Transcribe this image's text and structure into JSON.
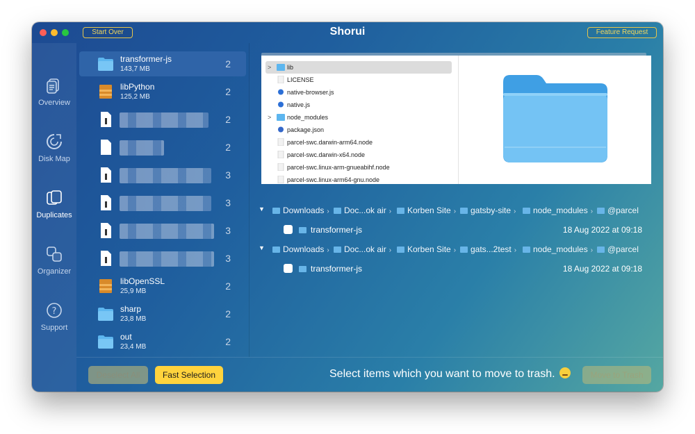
{
  "app": {
    "title": "Shorui",
    "start_over_label": "Start Over",
    "feature_request_label": "Feature Request"
  },
  "sidebar": {
    "items": [
      {
        "label": "Overview",
        "icon": "overview-icon"
      },
      {
        "label": "Disk Map",
        "icon": "disk-map-icon"
      },
      {
        "label": "Duplicates",
        "icon": "duplicates-icon",
        "active": true
      },
      {
        "label": "Organizer",
        "icon": "organizer-icon"
      },
      {
        "label": "Support",
        "icon": "support-icon"
      }
    ]
  },
  "files": [
    {
      "name": "transformer-js",
      "size": "143,7 MB",
      "count": "2",
      "icon": "folder-icon",
      "selected": true
    },
    {
      "name": "libPython",
      "size": "125,2 MB",
      "count": "2",
      "icon": "archive-icon"
    },
    {
      "name": "",
      "size": "",
      "count": "2",
      "icon": "document-icon",
      "blurred": true
    },
    {
      "name": "",
      "size": "",
      "count": "2",
      "icon": "document-icon",
      "blurred": true
    },
    {
      "name": "",
      "size": "",
      "count": "3",
      "icon": "document-icon",
      "blurred": true
    },
    {
      "name": "",
      "size": "",
      "count": "3",
      "icon": "document-icon",
      "blurred": true
    },
    {
      "name": "",
      "size": "",
      "count": "3",
      "icon": "document-icon",
      "blurred": true
    },
    {
      "name": "",
      "size": "",
      "count": "3",
      "icon": "document-icon",
      "blurred": true
    },
    {
      "name": "libOpenSSL",
      "size": "25,9 MB",
      "count": "2",
      "icon": "archive-icon"
    },
    {
      "name": "sharp",
      "size": "23,8 MB",
      "count": "2",
      "icon": "folder-icon"
    },
    {
      "name": "out",
      "size": "23,4 MB",
      "count": "2",
      "icon": "folder-icon"
    }
  ],
  "preview": {
    "tree": [
      {
        "label": "lib",
        "type": "folder",
        "expandable": true,
        "selected": true
      },
      {
        "label": "LICENSE",
        "type": "file"
      },
      {
        "label": "native-browser.js",
        "type": "js"
      },
      {
        "label": "native.js",
        "type": "js"
      },
      {
        "label": "node_modules",
        "type": "folder",
        "expandable": true
      },
      {
        "label": "package.json",
        "type": "json"
      },
      {
        "label": "parcel-swc.darwin-arm64.node",
        "type": "file"
      },
      {
        "label": "parcel-swc.darwin-x64.node",
        "type": "file"
      },
      {
        "label": "parcel-swc.linux-arm-gnueabihf.node",
        "type": "file"
      },
      {
        "label": "parcel-swc.linux-arm64-gnu.node",
        "type": "file"
      }
    ]
  },
  "groups": [
    {
      "path": [
        "Downloads",
        "Doc...ok air",
        "Korben Site",
        "gatsby-site",
        "node_modules",
        "@parcel"
      ],
      "item": {
        "name": "transformer-js",
        "date": "18 Aug 2022 at 09:18"
      }
    },
    {
      "path": [
        "Downloads",
        "Doc...ok air",
        "Korben Site",
        "gats...2test",
        "node_modules",
        "@parcel"
      ],
      "item": {
        "name": "transformer-js",
        "date": "18 Aug 2022 at 09:18"
      }
    }
  ],
  "bottom": {
    "deselect_all_label": "Deselect All",
    "fast_selection_label": "Fast Selection",
    "hint": "Select items which you want to move to trash.",
    "move_to_trash_label": "Move to Trash"
  }
}
